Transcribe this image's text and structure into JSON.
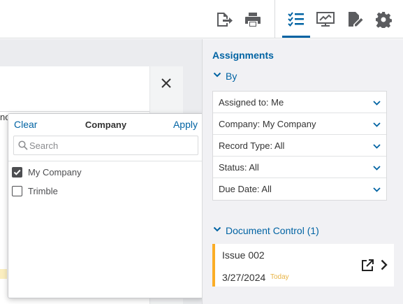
{
  "toolbar": {
    "icons": [
      "export-icon",
      "print-icon",
      "assignments-checklist-icon",
      "presentation-icon",
      "edit-document-icon",
      "settings-gear-icon"
    ],
    "active_icon": "assignments-checklist-icon",
    "icon_color": "#5b5c5f",
    "active_color": "#0063a3"
  },
  "left": {
    "partial_text": "no"
  },
  "popover": {
    "clear_label": "Clear",
    "title": "Company",
    "apply_label": "Apply",
    "search_placeholder": "Search",
    "options": [
      {
        "label": "My Company",
        "checked": true
      },
      {
        "label": "Trimble",
        "checked": false
      }
    ]
  },
  "panel": {
    "title": "Assignments",
    "by_label": "By",
    "filters": [
      {
        "label": "Assigned to: Me"
      },
      {
        "label": "Company: My Company"
      },
      {
        "label": "Record Type: All"
      },
      {
        "label": "Status: All"
      },
      {
        "label": "Due Date: All"
      }
    ],
    "group_label": "Document Control (1)",
    "card": {
      "title": "Issue 002",
      "date": "3/27/2024",
      "date_badge": "Today",
      "accent_color": "#fbad26"
    }
  }
}
